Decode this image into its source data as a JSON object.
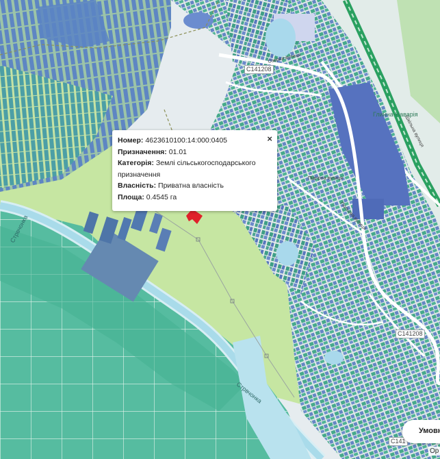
{
  "popup": {
    "number_label": "Номер:",
    "number_value": "4623610100:14:000:0405",
    "purpose_label": "Призначення:",
    "purpose_value": "01.01",
    "category_label": "Категорія:",
    "category_value": "Землі сільськогосподарського призначення",
    "ownership_label": "Власність:",
    "ownership_value": "Приватна власність",
    "area_label": "Площа:",
    "area_value": "0.4545 га",
    "close_glyph": "×"
  },
  "map_labels": {
    "road_c141": "C141208",
    "road_c141_b": "C141208",
    "road_c141_c": "C141",
    "river_1": "Стрвчонка",
    "river_2": "Стрвчонка",
    "station": "Глинна-Наварія",
    "street_1": "Озерна вулиця",
    "street_2": "Польова вулиця",
    "street_3": "Шкільна вулиця",
    "street_4": "Підгірна вулиця"
  },
  "controls": {
    "legend_button": "Умовні",
    "corner_text": "Ор"
  },
  "colors": {
    "farmland": "#c9e6a6",
    "field_light": "#dff0c4",
    "river_teal": "#56bfa2",
    "water": "#b8e2ee",
    "parcel_blue": "#5f83c2",
    "parcel_teal": "#3fa88c",
    "railway": "#2aa060",
    "selected_parcel": "#e0202a"
  }
}
